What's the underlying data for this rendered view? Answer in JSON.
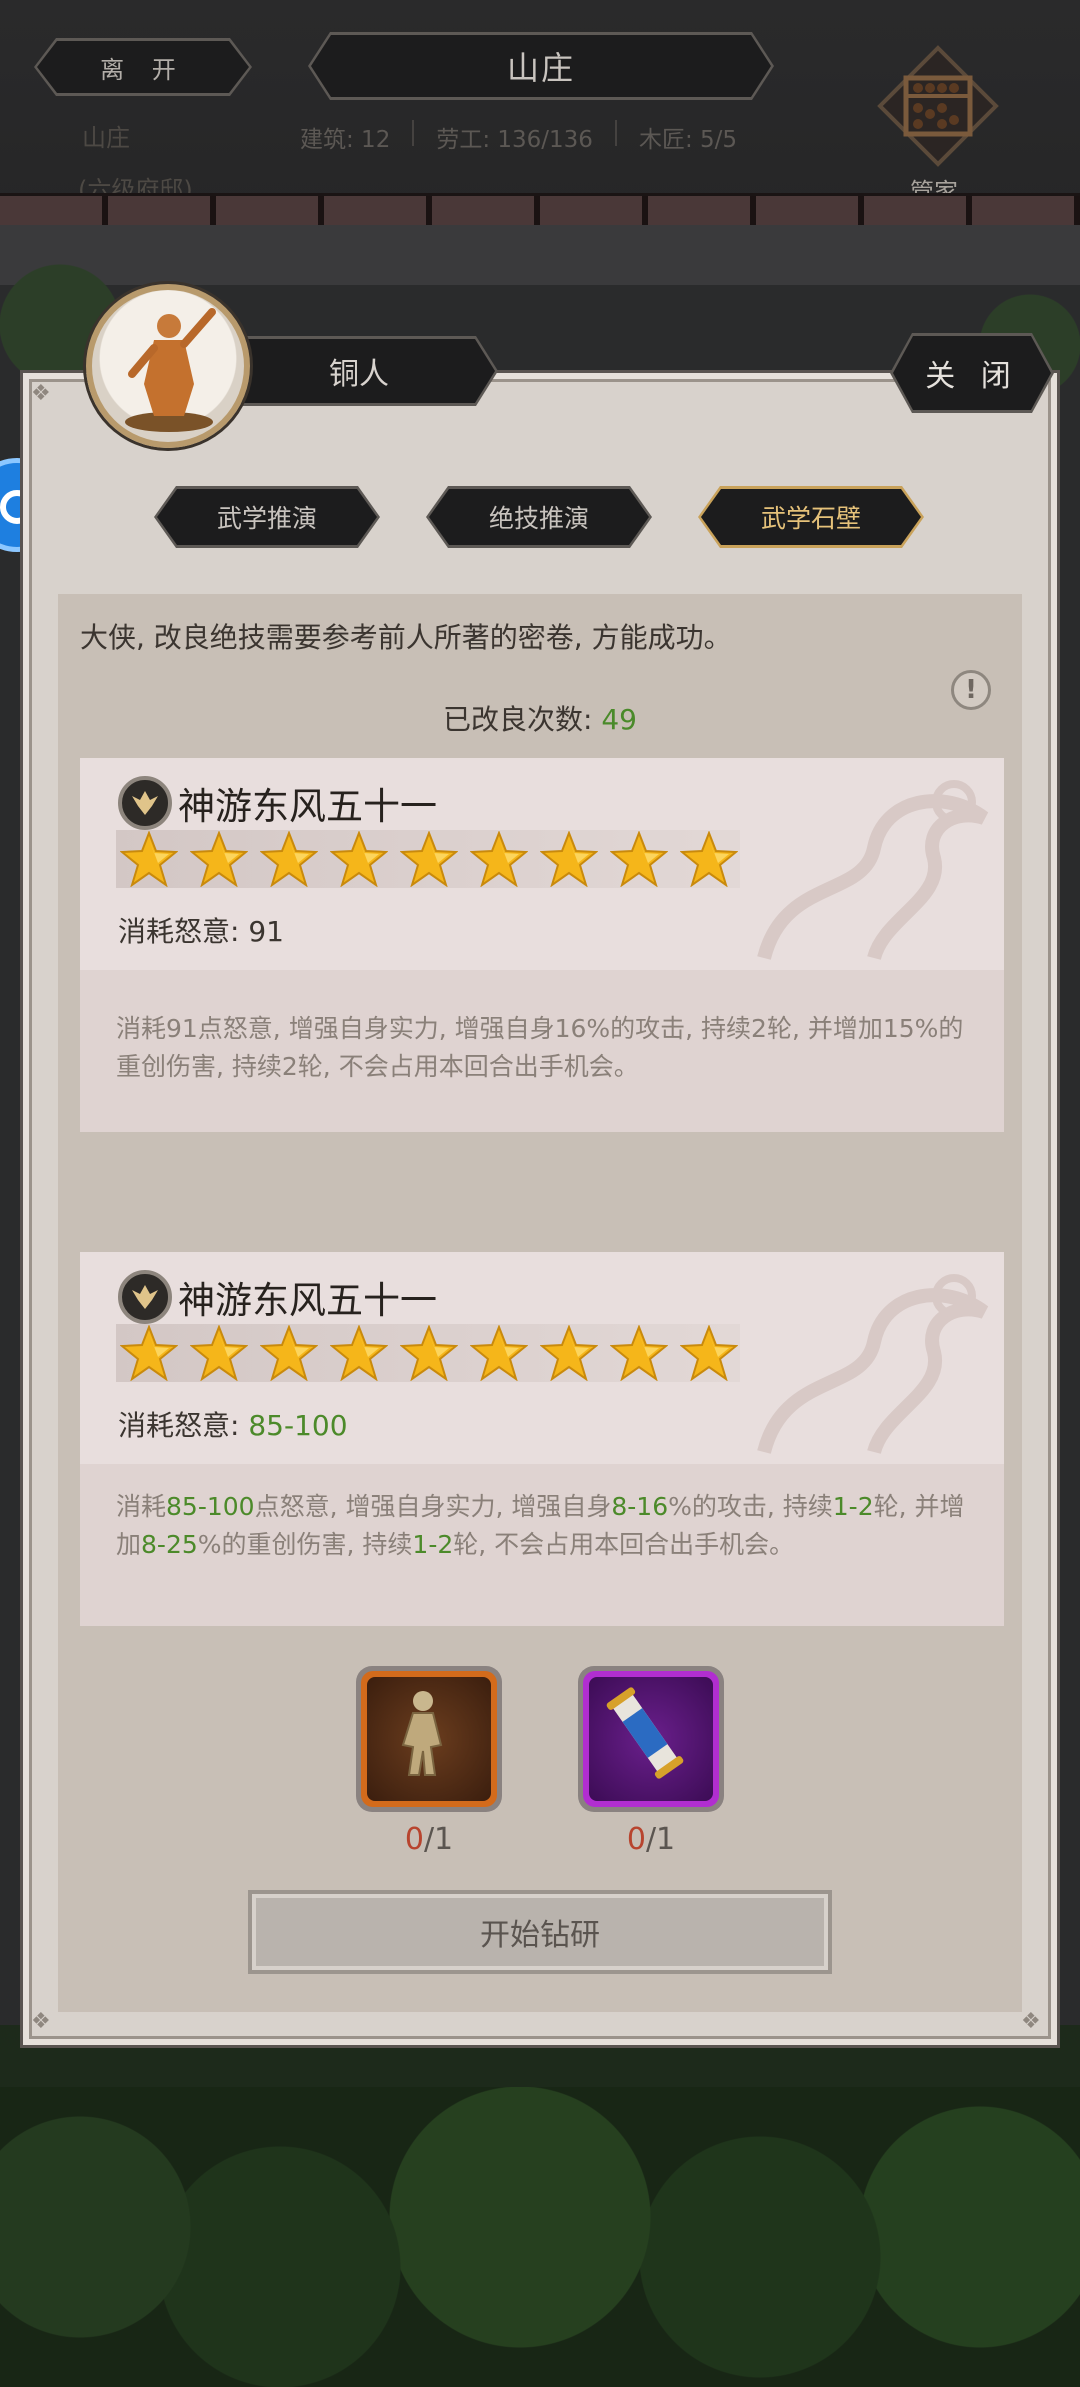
{
  "topbar": {
    "leave_label": "离 开",
    "title": "山庄",
    "estate_name": "山庄",
    "estate_rank": "(六级府邸)",
    "stats": {
      "buildings": "建筑: 12",
      "workers": "劳工: 136/136",
      "carpenters": "木匠: 5/5"
    },
    "steward_label": "管家"
  },
  "panel": {
    "character_name": "铜人",
    "close_label": "关 闭",
    "tabs": [
      {
        "label": "武学推演",
        "active": false
      },
      {
        "label": "绝技推演",
        "active": false
      },
      {
        "label": "武学石壁",
        "active": true
      }
    ],
    "intro": "大侠, 改良绝技需要参考前人所著的密卷, 方能成功。",
    "count_label": "已改良次数: ",
    "count_value": "49"
  },
  "cards": [
    {
      "name": "神游东风五十一",
      "stars": 9,
      "rage_label": "消耗怒意: ",
      "rage_value": "91",
      "desc": "消耗91点怒意, 增强自身实力, 增强自身16%的攻击, 持续2轮, 并增加15%的重创伤害, 持续2轮, 不会占用本回合出手机会。"
    },
    {
      "name": "神游东风五十一",
      "stars": 9,
      "rage_label": "消耗怒意: ",
      "rage_value": "85-100",
      "desc_parts": [
        "消耗",
        "85-100",
        "点怒意, 增强自身实力, 增强自身",
        "8-16",
        "%的攻击, 持续",
        "1-2",
        "轮, 并增加",
        "8-25",
        "%的重创伤害, 持续",
        "1-2",
        "轮, 不会占用本回合出手机会。"
      ]
    }
  ],
  "items": [
    {
      "icon": "bronze-figure-icon",
      "have": "0",
      "need": "/1",
      "frame_color": "#d36b1c"
    },
    {
      "icon": "scroll-icon",
      "have": "0",
      "need": "/1",
      "frame_color": "#b12ed0"
    }
  ],
  "start_label": "开始钻研",
  "colors": {
    "accent_green": "#4c8a2a",
    "gold_star": "#f5b61a",
    "tab_active": "#e6c27a"
  }
}
